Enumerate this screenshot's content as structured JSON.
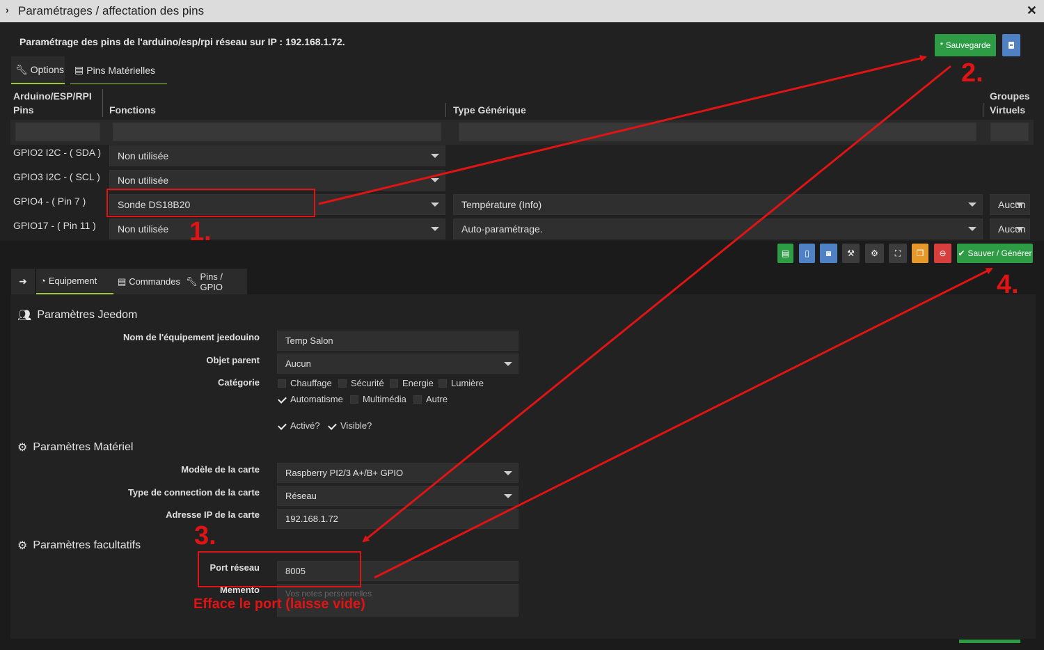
{
  "window": {
    "title": "Paramétrages / affectation des pins"
  },
  "pins_panel": {
    "heading": "Paramétrage des pins de l'arduino/esp/rpi réseau sur IP : 192.168.1.72.",
    "save_label": "* Sauvegarde",
    "tabs": [
      "Options",
      "Pins Matérielles"
    ],
    "columns": {
      "pins": "Arduino/ESP/RPI Pins",
      "functions": "Fonctions",
      "generic_type": "Type Générique",
      "virtual_groups": "Groupes Virtuels"
    },
    "rows": [
      {
        "pin": "GPIO2 I2C - ( SDA )",
        "function": "Non utilisée",
        "generic": "",
        "group": ""
      },
      {
        "pin": "GPIO3 I2C - ( SCL )",
        "function": "Non utilisée",
        "generic": "",
        "group": ""
      },
      {
        "pin": "GPIO4 - ( Pin 7 )",
        "function": "Sonde DS18B20",
        "generic": "Température (Info)",
        "group": "Aucun"
      },
      {
        "pin": "GPIO17 - ( Pin 11 )",
        "function": "Non utilisée",
        "generic": "Auto-paramétrage.",
        "group": "Aucun"
      }
    ]
  },
  "toolbar": {
    "save_generate_label": "Sauver / Générer",
    "icons": [
      "database-icon",
      "file-icon",
      "camera-icon",
      "wrench-icon",
      "cogs-icon",
      "expand-icon",
      "copy-icon",
      "minus-circle-icon"
    ],
    "colors": {
      "green": "#2e9c45",
      "blue": "#4f81c4",
      "orange": "#e6982a",
      "red": "#d73f3f",
      "accent": "#9cc63f"
    }
  },
  "eq_tabs": [
    "Equipement",
    "Commandes",
    "Pins / GPIO"
  ],
  "jeedom": {
    "section_title": "Paramètres Jeedom",
    "name_label": "Nom de l'équipement jeedouino",
    "name_value": "Temp Salon",
    "parent_label": "Objet parent",
    "parent_value": "Aucun",
    "category_label": "Catégorie",
    "categories": [
      {
        "name": "Chauffage",
        "checked": false
      },
      {
        "name": "Sécurité",
        "checked": false
      },
      {
        "name": "Energie",
        "checked": false
      },
      {
        "name": "Lumière",
        "checked": false
      },
      {
        "name": "Automatisme",
        "checked": true
      },
      {
        "name": "Multimédia",
        "checked": false
      },
      {
        "name": "Autre",
        "checked": false
      }
    ],
    "active_label": "Activé?",
    "visible_label": "Visible?"
  },
  "hardware": {
    "section_title": "Paramètres Matériel",
    "model_label": "Modèle de la carte",
    "model_value": "Raspberry PI2/3 A+/B+ GPIO",
    "connection_label": "Type de connection de la carte",
    "connection_value": "Réseau",
    "ip_label": "Adresse IP de la carte",
    "ip_value": "192.168.1.72"
  },
  "optional": {
    "section_title": "Paramètres facultatifs",
    "port_label": "Port réseau",
    "port_value": "8005",
    "memo_label": "Memento",
    "memo_placeholder": "Vos notes personnelles"
  },
  "annotations": {
    "step1": "1.",
    "step2": "2.",
    "step3": "3.",
    "step4": "4.",
    "note": "Efface le port (laisse vide)",
    "color": "#e01414"
  }
}
